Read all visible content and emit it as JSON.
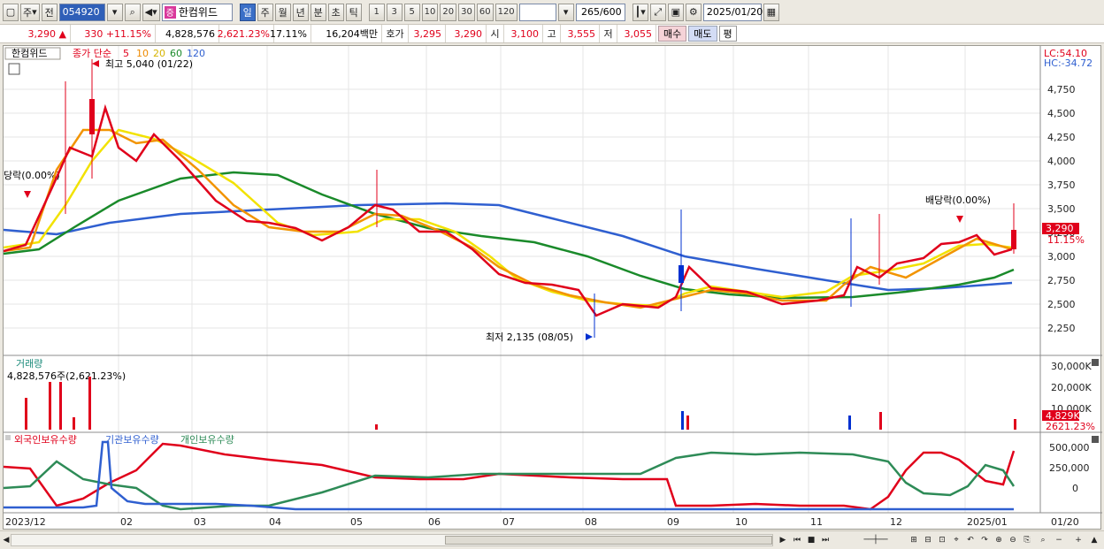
{
  "toolbar": {
    "market": "주",
    "prev_label": "전",
    "code": "054920",
    "name": "한컴위드",
    "badge": "증",
    "periods": [
      "일",
      "주",
      "월",
      "년",
      "분",
      "초",
      "틱"
    ],
    "numbers": [
      "1",
      "3",
      "5",
      "10",
      "20",
      "30",
      "60",
      "120"
    ],
    "count": "265",
    "count_total": "/600",
    "date": "2025/01/20"
  },
  "infobar": {
    "price": "3,290",
    "change_arrow": "▲",
    "change": "330",
    "change_pct": "+11.15%",
    "volume": "4,828,576",
    "volume_pct": "2,621.23%",
    "turnover": "17.11%",
    "amount": "16,204백만",
    "quote_label": "호가",
    "quote": "3,295",
    "quote2": "3,290",
    "open_label": "시",
    "open": "3,100",
    "high_label": "고",
    "high": "3,555",
    "low_label": "저",
    "low": "3,055",
    "buy": "매수",
    "sell": "매도",
    "flat": "평"
  },
  "price_panel": {
    "stock_label": "한컴위드",
    "ma_label": "종가 단순",
    "ma_periods": [
      "5",
      "10",
      "20",
      "60",
      "120"
    ],
    "ma_colors": [
      "#e0001b",
      "#ee8a00",
      "#e6c200",
      "#1a8a2a",
      "#2f5fd0"
    ],
    "high_annot": "최고 5,040 (01/22)",
    "low_annot": "최저 2,135 (08/05)",
    "left_annot": "당락(0.00%)",
    "right_annot": "배당락(0.00%)",
    "lc": "LC:54.10",
    "hc": "HC:-34.72",
    "last_price": "3,290",
    "last_pct": "11.15%",
    "y_ticks": [
      "4,750",
      "4,500",
      "4,250",
      "4,000",
      "3,750",
      "3,500",
      "3,250",
      "3,000",
      "2,750",
      "2,500",
      "2,250"
    ]
  },
  "volume_panel": {
    "title": "거래량",
    "readout": "4,828,576주(2,621.23%)",
    "y_ticks": [
      "30,000K",
      "20,000K",
      "10,000K"
    ],
    "last_val": "4,829K",
    "last_pct": "2621.23%"
  },
  "holder_panel": {
    "legend": [
      "외국인보유수량",
      "기관보유수량",
      "개인보유수량"
    ],
    "colors": [
      "#e0001b",
      "#2f5fd0",
      "#2e8b57"
    ],
    "y_ticks": [
      "500,000",
      "250,000",
      "0"
    ]
  },
  "x_axis": {
    "labels": [
      "2023/12",
      "02",
      "03",
      "04",
      "05",
      "06",
      "07",
      "08",
      "09",
      "10",
      "11",
      "12",
      "2025/01",
      "01/20"
    ]
  },
  "chart_data": {
    "type": "line",
    "title": "",
    "series": [
      {
        "name": "종가",
        "values": [
          3050,
          3020,
          3100,
          3250,
          3500,
          4000,
          4600,
          4300,
          4100,
          4000,
          3800,
          3600,
          3400,
          3300,
          3250,
          3200,
          3150,
          3100,
          3300,
          3500,
          3400,
          3300,
          3200,
          3100,
          3000,
          2800,
          2600,
          2550,
          2500,
          2300,
          2500,
          2450,
          2500,
          2600,
          2700,
          2650,
          2600,
          2550,
          2500,
          2500,
          2550,
          2650,
          2900,
          3050,
          3100,
          3150,
          3100,
          3050,
          3290
        ]
      },
      {
        "name": "거래량",
        "values": [
          0.5,
          0.8,
          14,
          8,
          22,
          4,
          27,
          2,
          1,
          1,
          0.5,
          0.5,
          0.5,
          0.5,
          0.5,
          0.5,
          0.5,
          0.5,
          0.5,
          0.5,
          0.5,
          0.5,
          0.5,
          0.5,
          0.5,
          0.5,
          0.5,
          0.5,
          0.5,
          0.5,
          0.5,
          0.5,
          0.5,
          0.5,
          0.5,
          0.5,
          0.5,
          0.5,
          0.5,
          0.5,
          0.5,
          0.5,
          9,
          4,
          9,
          2,
          1,
          1,
          4.83
        ]
      }
    ],
    "ylim": [
      2000,
      5100
    ]
  }
}
